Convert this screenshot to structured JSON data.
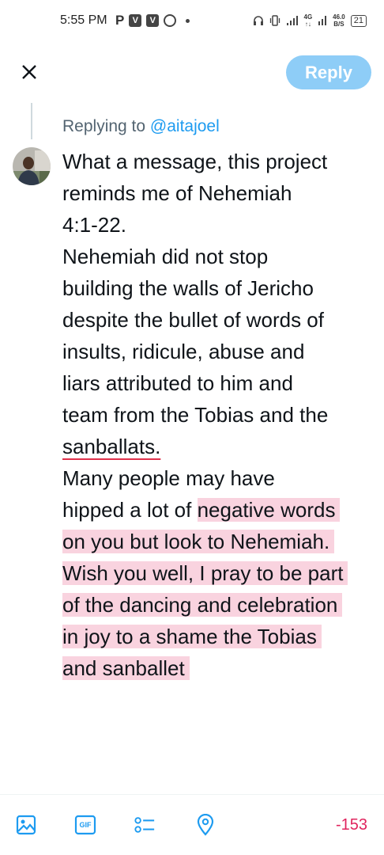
{
  "status_bar": {
    "time": "5:55 PM",
    "carrier_letter": "P",
    "v_badge": "V",
    "network_type": "4G",
    "speed_value": "46.0",
    "speed_unit": "B/S",
    "battery": "21"
  },
  "header": {
    "close_icon": "close-icon",
    "reply_label": "Reply",
    "reply_color": "#8ecdf7"
  },
  "reply_context": {
    "prefix": "Replying to",
    "handle": "@aitajoel"
  },
  "tweet_lines": [
    "What a message, this project",
    "reminds me of Nehemiah",
    "4:1-22.",
    "Nehemiah did not stop",
    "building the walls of Jericho",
    "despite the bullet of words of",
    "insults, ridicule, abuse and",
    "liars attributed to him and",
    "team from the Tobias and the",
    "sanballats.",
    "Many people  may have",
    "hipped a lot of",
    "negative words",
    "on you but look to Nehemiah.",
    "Wish you well, I pray to be part",
    "of the dancing and celebration",
    "in joy to a shame the Tobias",
    "and sanballet"
  ],
  "toolbar": {
    "icons": [
      "image-icon",
      "gif-icon",
      "poll-icon",
      "location-icon"
    ],
    "gif_label": "GIF",
    "char_count": "-153",
    "accent": "#1d9bf0",
    "error_color": "#e0245e"
  }
}
